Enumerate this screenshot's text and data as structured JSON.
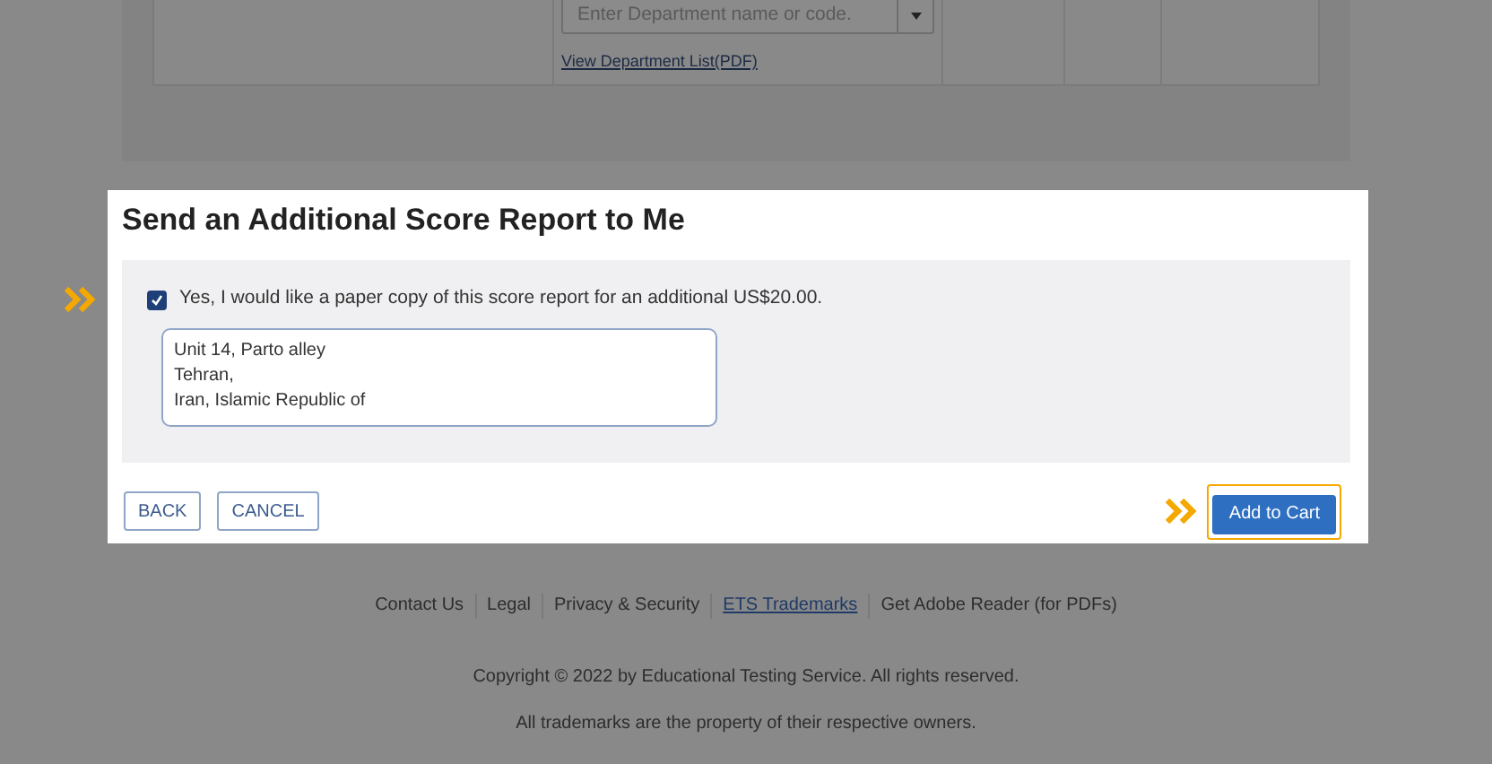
{
  "department_search": {
    "placeholder": "Enter Department name or code.",
    "link": "View Department List(PDF)"
  },
  "dialog": {
    "title": "Send an Additional Score Report to Me",
    "paper_copy": {
      "label": "Yes, I would like a paper copy of this score report for an additional US$20.00.",
      "checked": true,
      "highlighted": true
    },
    "address": [
      "Unit 14, Parto alley",
      "Tehran,",
      "Iran, Islamic Republic of"
    ],
    "buttons": [
      {
        "label": "BACK",
        "kind": "outline",
        "highlighted": false
      },
      {
        "label": "CANCEL",
        "kind": "outline",
        "highlighted": false
      },
      {
        "label": "Add to Cart",
        "kind": "primary",
        "highlighted": true
      }
    ]
  },
  "footer": {
    "links": [
      {
        "label": "Contact Us",
        "underlined": false
      },
      {
        "label": "Legal",
        "underlined": false
      },
      {
        "label": "Privacy & Security",
        "underlined": false
      },
      {
        "label": "ETS Trademarks",
        "underlined": true
      },
      {
        "label": "Get Adobe Reader (for PDFs)",
        "underlined": false
      }
    ],
    "copyright": "Copyright © 2022 by Educational Testing Service. All rights reserved.",
    "trademarks": "All trademarks are the property of their respective owners."
  }
}
